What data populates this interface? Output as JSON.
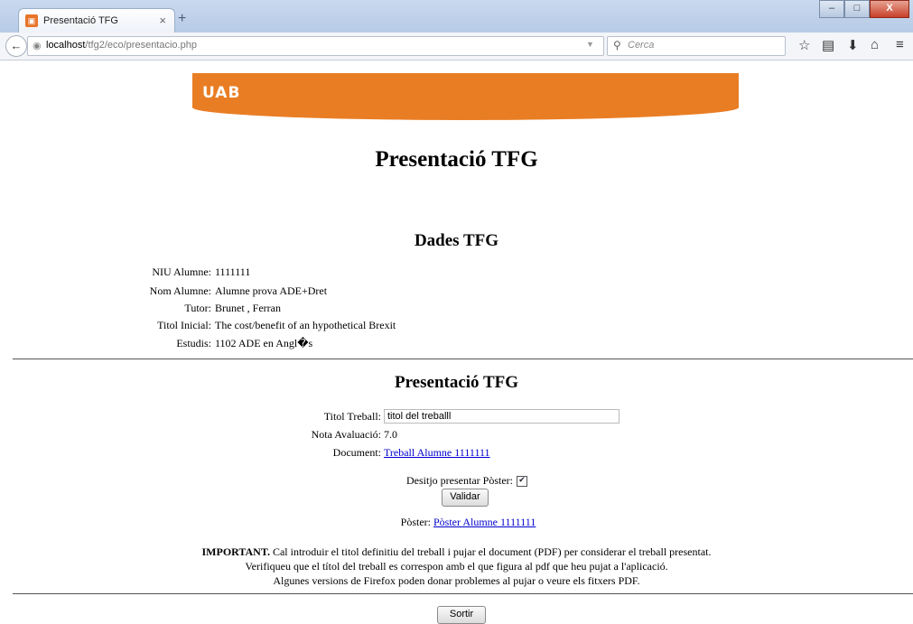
{
  "browser": {
    "tab_title": "Presentació TFG",
    "tab_close": "×",
    "new_tab": "+",
    "url_host": "localhost",
    "url_path": "/tfg2/eco/presentacio.php",
    "search_placeholder": "Cerca",
    "window_buttons": [
      "–",
      "□",
      "X"
    ]
  },
  "page": {
    "logo": "UAB",
    "title": "Presentació TFG",
    "dades": {
      "heading": "Dades TFG",
      "rows": [
        {
          "label": "NIU Alumne:",
          "value": "1111111"
        },
        {
          "label": "Nom Alumne:",
          "value": "Alumne prova ADE+Dret"
        },
        {
          "label": "Tutor:",
          "value": "Brunet , Ferran"
        },
        {
          "label": "Titol Inicial:",
          "value": "The cost/benefit of an hypothetical Brexit"
        },
        {
          "label": "Estudis:",
          "value": "1102 ADE en Angl�s"
        }
      ]
    },
    "presentacio": {
      "heading": "Presentació TFG",
      "titol_label": "Titol Treball:",
      "titol_value": "titol del treballl",
      "nota_label": "Nota Avaluació:",
      "nota_value": "7.0",
      "document_label": "Document:",
      "document_link": "Treball Alumne 1111111",
      "poster_check_label": "Desitjo presentar Pòster:",
      "poster_checked": true,
      "validar": "Validar",
      "poster_label": "Pòster:",
      "poster_link": "Pòster Alumne 1111111"
    },
    "notice": {
      "important": "IMPORTANT.",
      "line1": " Cal introduir el titol definitiu del treball i pujar el document (PDF) per considerar el treball presentat.",
      "line2": "Verifiqueu que el títol del treball es correspon amb el que figura al pdf que heu pujat a l'aplicació.",
      "line3": "Algunes versions de Firefox poden donar problemes al pujar o veure els fitxers PDF."
    },
    "sortir": "Sortir"
  }
}
